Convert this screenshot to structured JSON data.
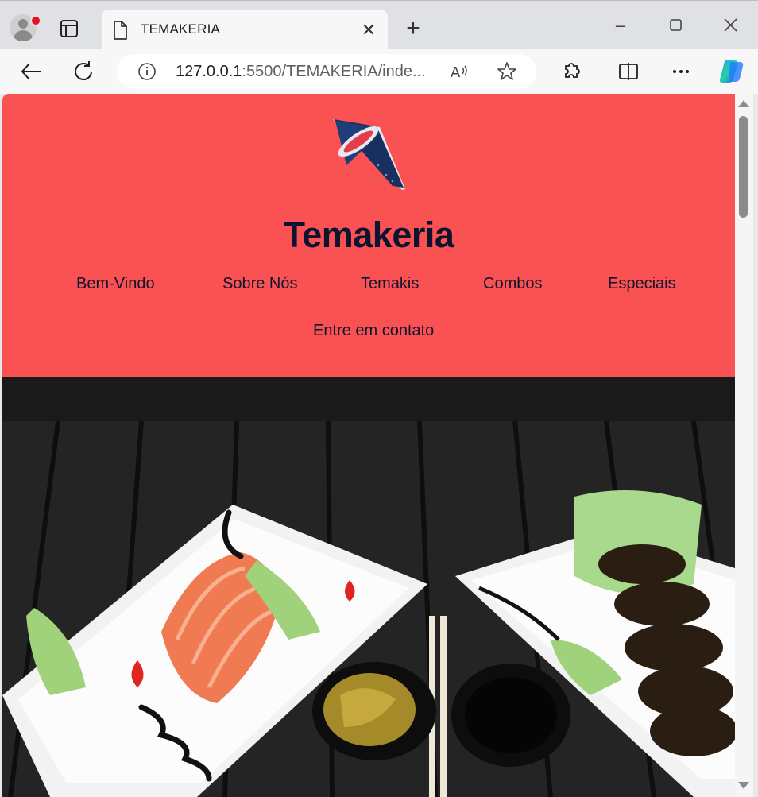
{
  "browser": {
    "tab_title": "TEMAKERIA",
    "url_host": "127.0.0.1",
    "url_rest": ":5500/TEMAKERIA/inde...",
    "read_aloud_glyph": "Aᵢ⁾",
    "icons": [
      "profile-avatar",
      "workspaces-icon",
      "page-icon",
      "close-icon",
      "plus-icon",
      "minimize-icon",
      "maximize-icon",
      "close-window-icon",
      "back-icon",
      "refresh-icon",
      "info-icon",
      "read-aloud-icon",
      "favorite-star-icon",
      "extensions-icon",
      "split-screen-icon",
      "more-icon",
      "copilot-icon"
    ]
  },
  "site": {
    "brand": "Temakeria",
    "colors": {
      "header_bg": "#fa5252",
      "text_navy": "#0d1430"
    },
    "menu": [
      "Bem-Vindo",
      "Sobre Nós",
      "Temakis",
      "Combos",
      "Especiais",
      "Entre em contato"
    ],
    "hero_alt": "sashimi plates"
  }
}
